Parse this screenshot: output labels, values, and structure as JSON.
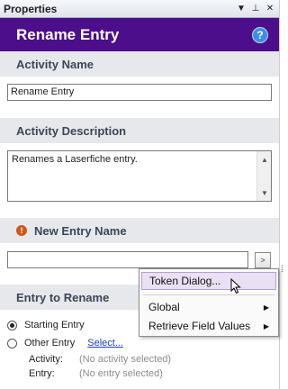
{
  "window": {
    "title": "Properties",
    "icons": [
      "dropdown-icon",
      "pin-icon",
      "close-icon"
    ]
  },
  "header": {
    "title": "Rename Entry",
    "help": "?"
  },
  "activity_name": {
    "heading": "Activity Name",
    "value": "Rename Entry"
  },
  "activity_description": {
    "heading": "Activity Description",
    "value": "Renames a Laserfiche entry."
  },
  "new_entry_name": {
    "heading": "New Entry Name",
    "value": "",
    "browse": ">"
  },
  "context_menu": {
    "items": [
      {
        "label": "Token Dialog...",
        "submenu": false,
        "highlighted": true
      },
      {
        "label": "Global",
        "submenu": true,
        "highlighted": false
      },
      {
        "label": "Retrieve Field Values",
        "submenu": true,
        "highlighted": false
      }
    ]
  },
  "entry_to_rename": {
    "heading": "Entry to Rename",
    "starting_entry": "Starting Entry",
    "other_entry": "Other Entry",
    "select_link": "Select...",
    "activity_label": "Activity:",
    "activity_value": "(No activity selected)",
    "entry_label": "Entry:",
    "entry_value": "(No entry selected)"
  },
  "colors": {
    "header_bg": "#4c0e8a",
    "section_bg": "#e6e8ec",
    "menu_highlight": "#e9e0f3",
    "link": "#1a3ec7",
    "warning": "#d2561b"
  }
}
